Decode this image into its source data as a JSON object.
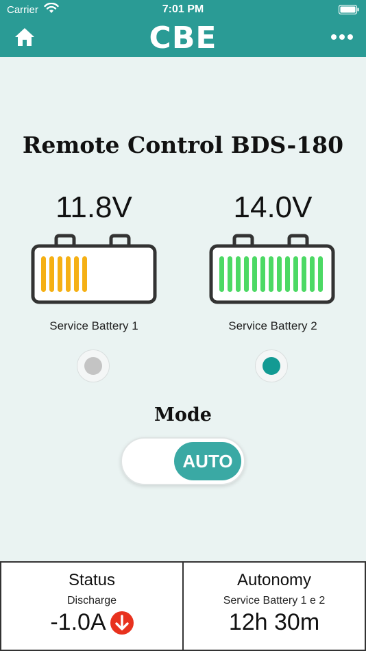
{
  "status_bar": {
    "carrier": "Carrier",
    "time": "7:01 PM",
    "icons": [
      "wifi-icon",
      "battery-icon"
    ]
  },
  "nav": {
    "brand": "CBE",
    "left_icon": "home-icon",
    "right_icon": "more-dots-icon"
  },
  "title": "Remote Control BDS-180",
  "batteries": [
    {
      "label": "Service Battery 1",
      "voltage": "11.8V",
      "charge_bars": 6,
      "max_bars": 13,
      "color": "#f5b014",
      "selected": false
    },
    {
      "label": "Service Battery 2",
      "voltage": "14.0V",
      "charge_bars": 13,
      "max_bars": 13,
      "color": "#4cd964",
      "selected": true
    }
  ],
  "mode": {
    "label": "Mode",
    "toggle_value": "AUTO",
    "accent": "#3aa9a4"
  },
  "status_panel": {
    "title": "Status",
    "subtitle": "Discharge",
    "value": "-1.0A",
    "indicator_icon": "arrow-down-icon",
    "indicator_color": "#e8321e"
  },
  "autonomy_panel": {
    "title": "Autonomy",
    "subtitle": "Service Battery 1 e 2",
    "value": "12h 30m"
  },
  "colors": {
    "header": "#2a9b95",
    "background": "#eaf3f2"
  }
}
